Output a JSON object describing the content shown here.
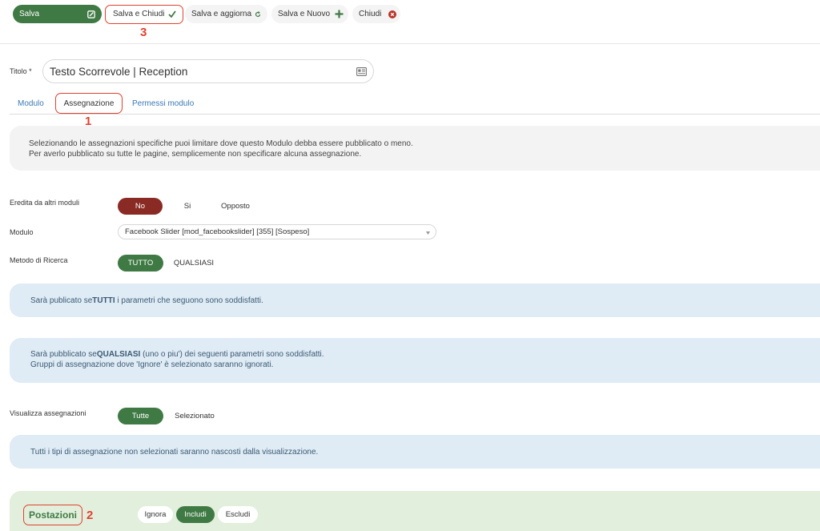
{
  "toolbar": {
    "save": "Salva",
    "save_close": "Salva e Chiudi",
    "save_update": "Salva e aggiorna",
    "save_new": "Salva e Nuovo",
    "close": "Chiudi",
    "callout": "3"
  },
  "title": {
    "label": "Titolo *",
    "value": "Testo Scorrevole | Reception"
  },
  "tabs": {
    "module": "Modulo",
    "assignment": "Assegnazione",
    "permissions": "Permessi modulo",
    "callout": "1"
  },
  "intro": {
    "line1": "Selezionando le assegnazioni specifiche puoi limitare dove questo Modulo debba essere pubblicato o meno.",
    "line2": "Per averlo pubblicato su tutte le pagine, semplicemente non specificare alcuna assegnazione."
  },
  "inherit": {
    "label": "Eredita da altri moduli",
    "no": "No",
    "yes": "Si",
    "opposite": "Opposto"
  },
  "module_select": {
    "label": "Modulo",
    "value": "Facebook Slider [mod_facebookslider] [355] [Sospeso]"
  },
  "search_method": {
    "label": "Metodo di Ricerca",
    "all": "TUTTO",
    "any": "QUALSIASI"
  },
  "info_all": {
    "pre": "Sarà publicato se",
    "bold": "TUTTI",
    "post": " i parametri che seguono sono soddisfatti."
  },
  "info_any": {
    "pre": "Sarà pubblicato se",
    "bold": "QUALSIASI",
    "post": " (uno o piu') dei seguenti parametri sono soddisfatti.",
    "line2": "Gruppi di assegnazione dove 'Ignore' è selezionato saranno ignorati."
  },
  "view_assign": {
    "label": "Visualizza assegnazioni",
    "all": "Tutte",
    "selected": "Selezionato"
  },
  "info_hidden": {
    "text": "Tutti i tipi di assegnazione non selezionati saranno nascosti dalla visualizzazione."
  },
  "postazioni": {
    "title": "Postazioni",
    "ignore": "Ignora",
    "include": "Includi",
    "exclude": "Escludi",
    "callout": "2"
  }
}
